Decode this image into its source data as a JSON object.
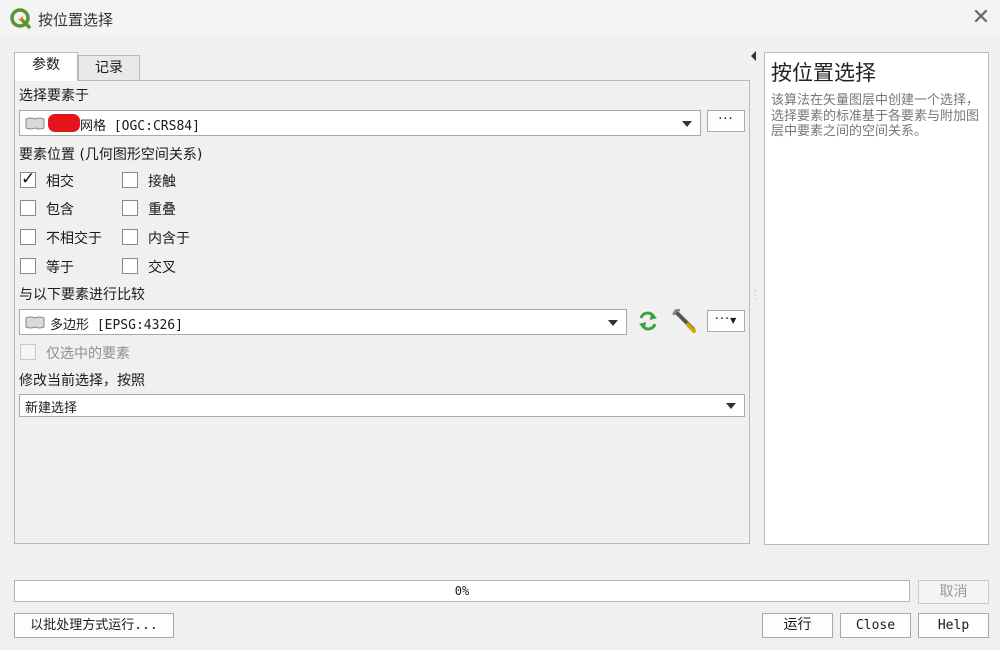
{
  "window": {
    "title": "按位置选择",
    "close_glyph": "✕"
  },
  "tabs": [
    {
      "label": "参数"
    },
    {
      "label": "记录"
    }
  ],
  "params": {
    "select_features_in": {
      "label": "选择要素于",
      "layer_value": "网格 [OGC:CRS84]",
      "layer_icon": "polygon-layer-icon",
      "redaction_color": "#e8141c",
      "more_label": "···"
    },
    "predicate": {
      "label": "要素位置 (几何图形空间关系)",
      "options": [
        {
          "label": "相交",
          "checked": true
        },
        {
          "label": "接触",
          "checked": false
        },
        {
          "label": "包含",
          "checked": false
        },
        {
          "label": "重叠",
          "checked": false
        },
        {
          "label": "不相交于",
          "checked": false
        },
        {
          "label": "内含于",
          "checked": false
        },
        {
          "label": "等于",
          "checked": false
        },
        {
          "label": "交叉",
          "checked": false
        }
      ],
      "check_glyph": "✓"
    },
    "compare_with": {
      "label": "与以下要素进行比较",
      "layer_value": "多边形 [EPSG:4326]",
      "layer_icon": "polygon-layer-icon",
      "iterate_icon": "iterate-icon",
      "settings_icon": "wrench-icon",
      "more_label": "···",
      "selected_only_label": "仅选中的要素",
      "selected_only_checked": false
    },
    "modify_selection": {
      "label": "修改当前选择，按照",
      "value": "新建选择"
    }
  },
  "help": {
    "title": "按位置选择",
    "body": "该算法在矢量图层中创建一个选择，选择要素的标准基于各要素与附加图层中要素之间的空间关系。"
  },
  "footer": {
    "progress_text": "0%",
    "progress_value": 0,
    "cancel_label": "取消",
    "batch_label": "以批处理方式运行...",
    "run_label": "运行",
    "close_label": "Close",
    "help_label": "Help"
  },
  "colors": {
    "qgis_green": "#589632",
    "iterate_green": "#3aa33a",
    "window_bg": "#f0f0f0"
  }
}
